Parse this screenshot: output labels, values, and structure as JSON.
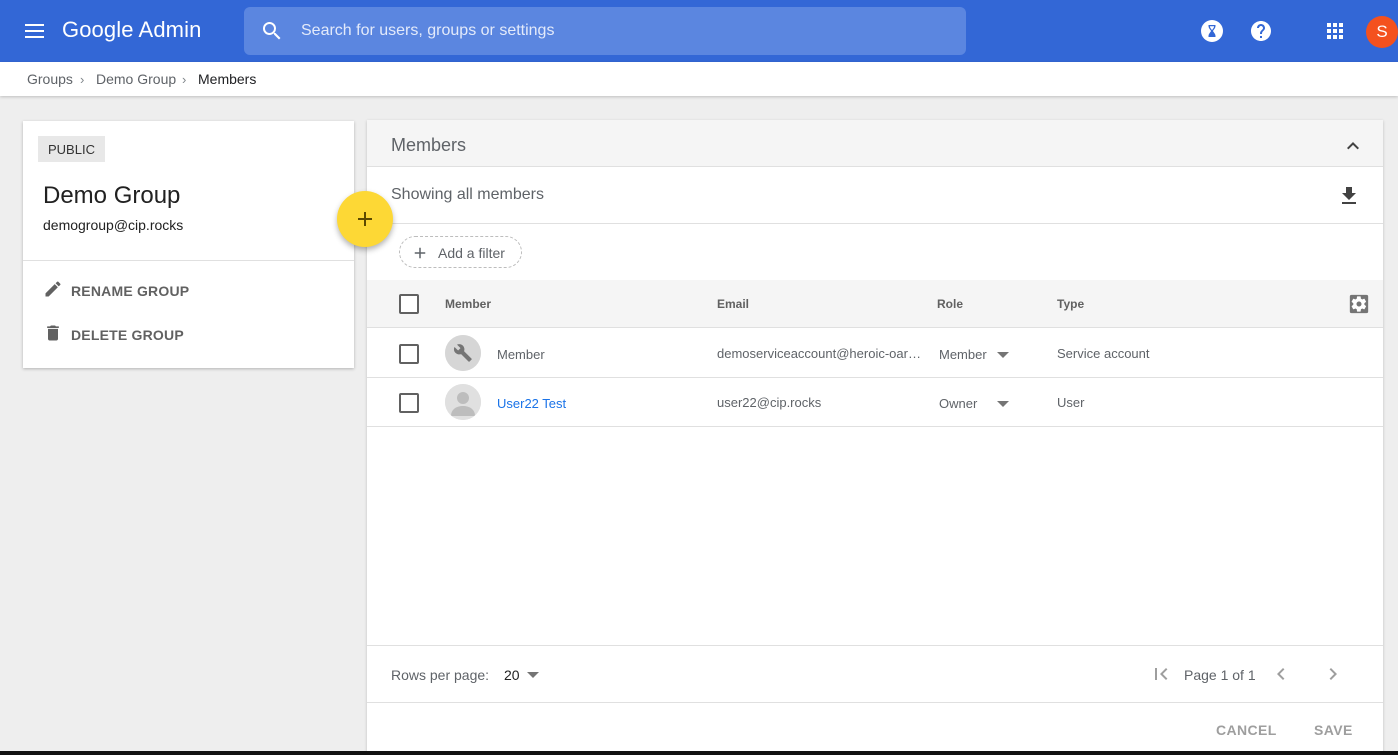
{
  "app": {
    "title": "Google Admin",
    "user_initial": "S",
    "avatar_color": "#f4511e",
    "brand_color": "#3367d6"
  },
  "search": {
    "placeholder": "Search for users, groups or settings",
    "value": ""
  },
  "topbar_icons": [
    "hourglass-icon",
    "help-icon",
    "apps-grid-icon"
  ],
  "breadcrumb": [
    "Groups",
    "Demo Group",
    "Members"
  ],
  "group": {
    "visibility": "PUBLIC",
    "name": "Demo Group",
    "email": "demogroup@cip.rocks",
    "actions": {
      "rename": "RENAME GROUP",
      "delete": "DELETE GROUP"
    }
  },
  "members": {
    "title": "Members",
    "showing": "Showing all members",
    "filter_label": "Add a filter",
    "columns": {
      "member": "Member",
      "email": "Email",
      "role": "Role",
      "type": "Type"
    },
    "rows": [
      {
        "name": "Member",
        "email": "demoserviceaccount@heroic-oar…",
        "role": "Member",
        "type": "Service account",
        "avatar": "wrench-icon",
        "linked": false
      },
      {
        "name": "User22 Test",
        "email": "user22@cip.rocks",
        "role": "Owner",
        "type": "User",
        "avatar": "person-icon",
        "linked": true
      }
    ],
    "footer": {
      "rows_per_page_label": "Rows per page:",
      "rows_per_page": "20",
      "page_info": "Page 1 of 1",
      "cancel": "CANCEL",
      "save": "SAVE"
    }
  }
}
